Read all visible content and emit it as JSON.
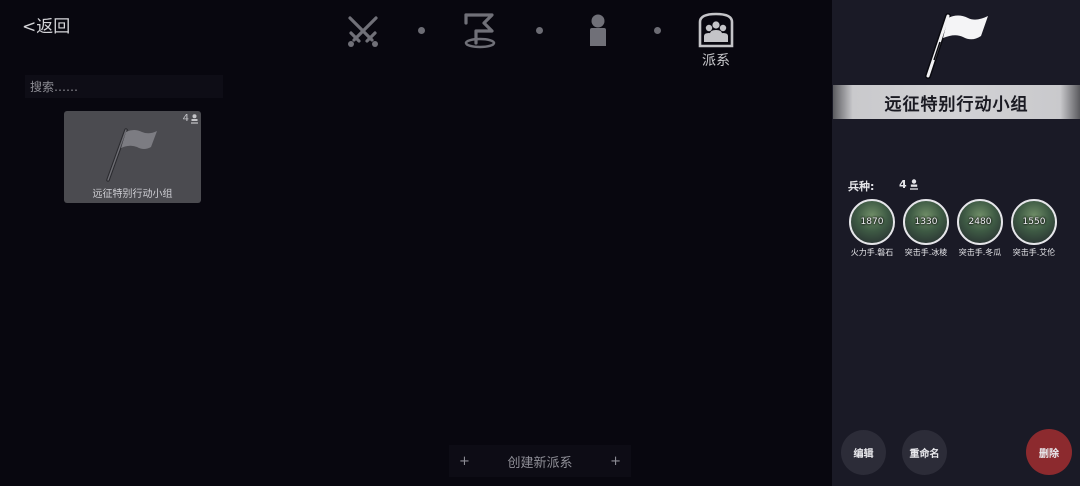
{
  "nav": {
    "back_label": "<返回",
    "active_tab_label": "派系"
  },
  "search": {
    "placeholder": "搜索……"
  },
  "faction_card": {
    "name": "远征特别行动小组",
    "count": "4"
  },
  "create_button": {
    "plus_left": "+",
    "label": "创建新派系",
    "plus_right": "+"
  },
  "detail": {
    "title": "远征特别行动小组",
    "troop_label": "兵种:",
    "troop_count": "4",
    "soldiers": [
      {
        "power": "1870",
        "name": "火力手.磐石"
      },
      {
        "power": "1330",
        "name": "突击手.冰棱"
      },
      {
        "power": "2480",
        "name": "突击手.冬瓜"
      },
      {
        "power": "1550",
        "name": "突击手.艾伦"
      }
    ]
  },
  "actions": {
    "edit": "编辑",
    "rename": "重命名",
    "delete": "删除"
  },
  "colors": {
    "background": "#08070f",
    "panel": "#1a1a26",
    "card": "#4b4b50",
    "delete_button": "#8c2a2e"
  },
  "icons": [
    "swords-icon",
    "flag-icon",
    "person-icon",
    "faction-icon",
    "person-small-icon"
  ]
}
